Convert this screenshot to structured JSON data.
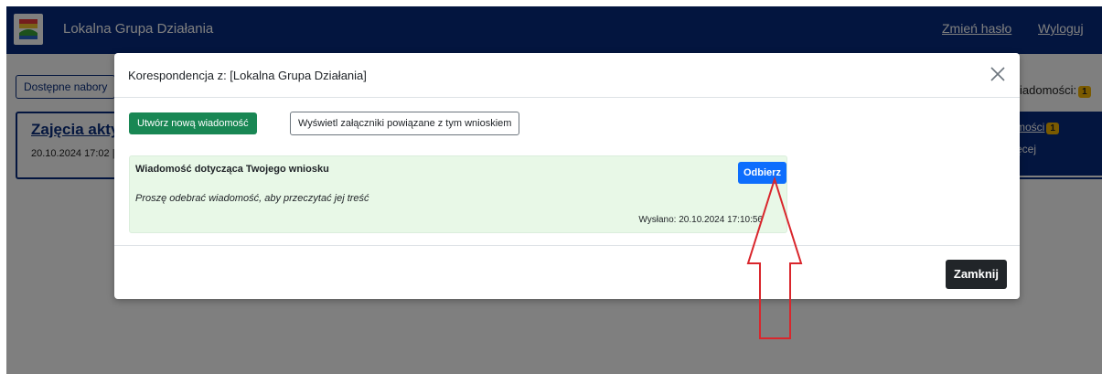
{
  "navbar": {
    "brand": "Lokalna Grupa Działania",
    "change_password": "Zmień hasło",
    "logout": "Wyloguj"
  },
  "background": {
    "tab_button": "Dostępne nabory",
    "card_title": "Zajęcia akty",
    "card_date": "20.10.2024 17:02 |",
    "messages_label": "iadomości:",
    "messages_count": "1",
    "right_link": "mości",
    "right_link_count": "1",
    "right_more": "ęcej"
  },
  "modal": {
    "title": "Korespondencja z: [Lokalna Grupa Działania]",
    "new_message_button": "Utwórz nową wiadomość",
    "attachments_button": "Wyświetl załączniki powiązane z tym wnioskiem",
    "message": {
      "subject": "Wiadomość dotycząca Twojego wniosku",
      "body": "Proszę odebrać wiadomość, aby przeczytać jej treść",
      "sent": "Wysłano: 20.10.2024 17:10:56",
      "receive_button": "Odbierz"
    },
    "close_button": "Zamknij"
  },
  "colors": {
    "navbar": "#072a7e",
    "success": "#198754",
    "primary": "#0d6efd",
    "dark": "#212529",
    "message_bg": "#e8f8e7",
    "arrow": "#d9262c",
    "badge": "#f4b400"
  },
  "icons": {
    "close": "close-icon",
    "logo": "lgd-logo",
    "annotation": "up-arrow-annotation"
  }
}
